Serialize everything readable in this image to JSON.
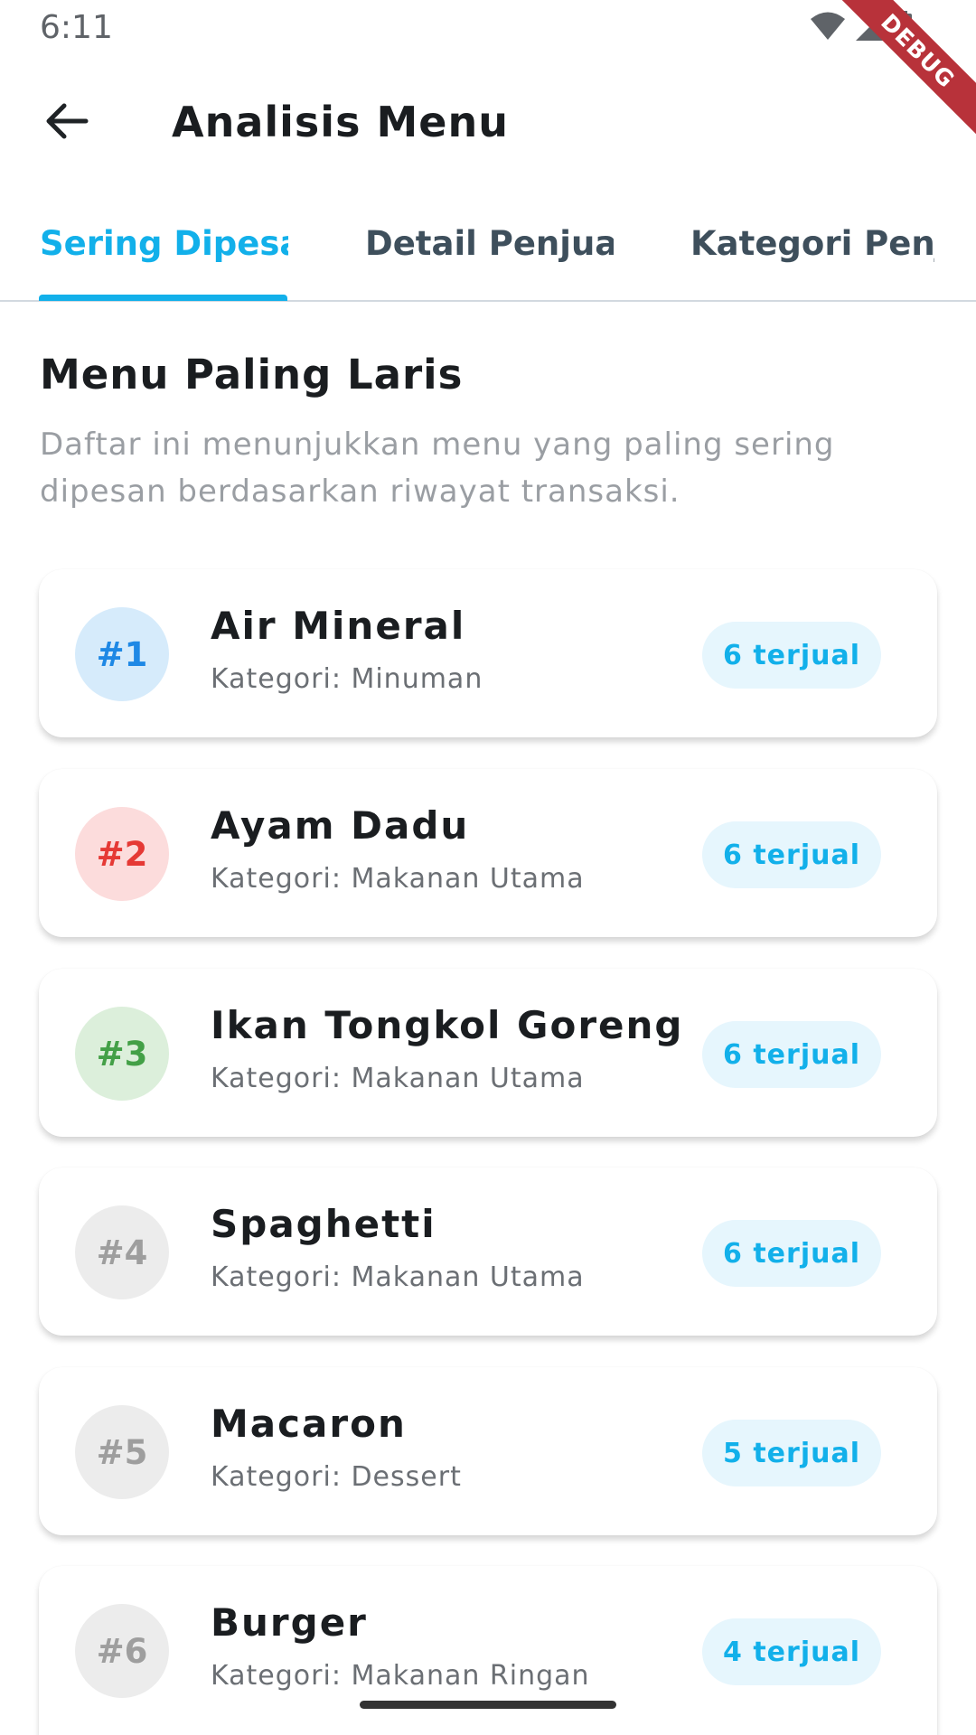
{
  "status_bar": {
    "time": "6:11",
    "debug_label": "DEBUG"
  },
  "app_bar": {
    "title": "Analisis Menu"
  },
  "tabs": [
    {
      "label": "Sering Dipesan"
    },
    {
      "label": "Detail Penjualan"
    },
    {
      "label": "Kategori Penjualan"
    }
  ],
  "section": {
    "title": "Menu Paling Laris",
    "description": "Daftar ini menunjukkan menu yang paling sering dipesan berdasarkan riwayat transaksi."
  },
  "items": [
    {
      "rank": "#1",
      "name": "Air Mineral",
      "category": "Kategori: Minuman",
      "sold": "6 terjual",
      "badge_bg": "#d6ebfb",
      "badge_color": "#1e88e5"
    },
    {
      "rank": "#2",
      "name": "Ayam Dadu",
      "category": "Kategori: Makanan Utama",
      "sold": "6 terjual",
      "badge_bg": "#fcdcdc",
      "badge_color": "#e53935"
    },
    {
      "rank": "#3",
      "name": "Ikan Tongkol Goreng",
      "category": "Kategori: Makanan Utama",
      "sold": "6 terjual",
      "badge_bg": "#dcefdb",
      "badge_color": "#43a047"
    },
    {
      "rank": "#4",
      "name": "Spaghetti",
      "category": "Kategori: Makanan Utama",
      "sold": "6 terjual",
      "badge_bg": "#ececec",
      "badge_color": "#9e9e9e"
    },
    {
      "rank": "#5",
      "name": "Macaron",
      "category": "Kategori: Dessert",
      "sold": "5 terjual",
      "badge_bg": "#ececec",
      "badge_color": "#9e9e9e"
    },
    {
      "rank": "#6",
      "name": "Burger",
      "category": "Kategori: Makanan Ringan",
      "sold": "4 terjual",
      "badge_bg": "#ececec",
      "badge_color": "#9e9e9e"
    }
  ],
  "colors": {
    "accent": "#12b0ea",
    "pill_bg": "#e6f6fd"
  },
  "icons": {
    "back": "arrow-left-icon",
    "wifi": "wifi-icon",
    "signal": "signal-icon",
    "battery": "battery-icon"
  }
}
